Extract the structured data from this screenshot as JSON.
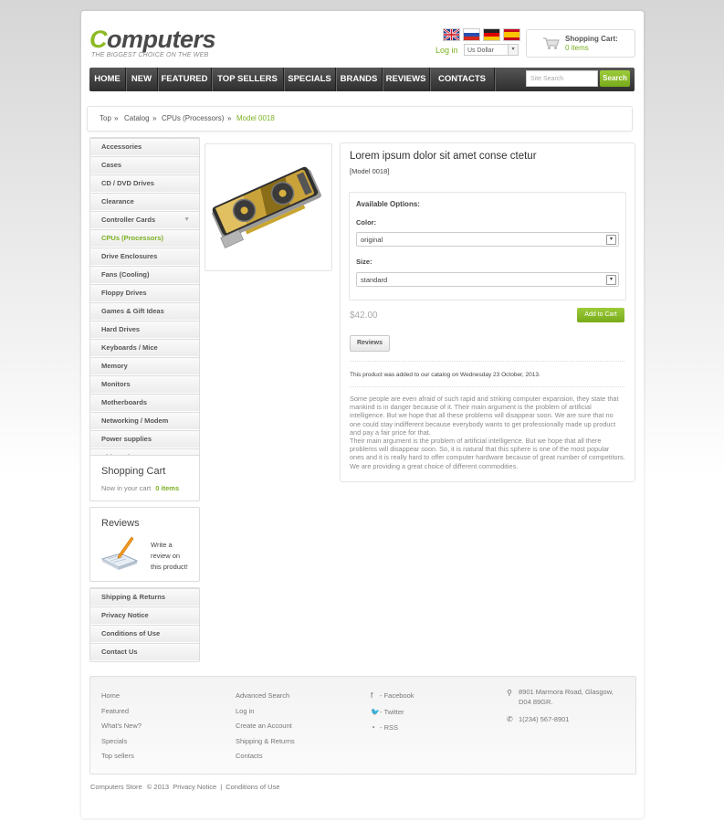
{
  "header": {
    "logo_first_letter": "C",
    "logo_rest": "omputers",
    "tagline": "THE BIGGEST CHOICE ON THE WEB",
    "login_label": "Log in",
    "currency_selected": "Us Dollar",
    "cart_title": "Shopping Cart:",
    "cart_items": "0 items",
    "flags": [
      "uk-flag-icon",
      "russia-flag-icon",
      "germany-flag-icon",
      "spain-flag-icon"
    ]
  },
  "nav": {
    "items": [
      "HOME",
      "NEW",
      "FEATURED",
      "TOP SELLERS",
      "SPECIALS",
      "BRANDS",
      "REVIEWS",
      "CONTACTS"
    ],
    "search_placeholder": "Site Search",
    "search_button": "Search"
  },
  "breadcrumb": {
    "items": [
      "Top",
      "Catalog",
      "CPUs (Processors)",
      "Model 0018"
    ],
    "separator": "»"
  },
  "categories": [
    "Accessories",
    "Cases",
    "CD / DVD Drives",
    "Clearance",
    "Controller Cards",
    "CPUs (Processors)",
    "Drive Enclosures",
    "Fans (Cooling)",
    "Floppy Drives",
    "Games & Gift Ideas",
    "Hard Drives",
    "Keyboards / Mice",
    "Memory",
    "Monitors",
    "Motherboards",
    "Networking / Modem",
    "Power supplies",
    "Video adapters"
  ],
  "active_category": "CPUs (Processors)",
  "sidebar_cart": {
    "title": "Shopping Cart",
    "text": "Now in your cart",
    "items": "0 items"
  },
  "sidebar_reviews": {
    "title": "Reviews",
    "line1": "Write a",
    "line2": "review on",
    "line3": "this product!"
  },
  "info_links": [
    "Shipping & Returns",
    "Privacy Notice",
    "Conditions of Use",
    "Contact Us"
  ],
  "product": {
    "title": "Lorem ipsum dolor sit amet conse ctetur",
    "model": "[Model 0018]",
    "options_heading": "Available Options:",
    "color_label": "Color:",
    "color_value": "original",
    "size_label": "Size:",
    "size_value": "standard",
    "price": "$42.00",
    "add_to_cart": "Add to Cart",
    "reviews_button": "Reviews",
    "added_text": "This product was added to our catalog on Wednesday 23 October, 2013.",
    "description_1": "Some people are even afraid of such rapid and striking computer expansion, they state that mankind is in danger because of it. Their main argument is the problem of artificial intelligence. But we hope that all these problems will disappear soon. We are sure that no one could stay indifferent because everybody wants to get professionally made up product and pay a fair price for that.",
    "description_2": "Their main argument is the problem of artificial intelligence. But we hope that all there problems will disappear soon. So, it is natural that this sphere is one of the most popular ones and it is really hard to offer computer hardware because of great number of competitors. We are providing a great choice of different commodities."
  },
  "footer": {
    "col1": [
      "Home",
      "Featured",
      "What's New?",
      "Specials",
      "Top sellers"
    ],
    "col2": [
      "Advanced Search",
      "Log in",
      "Create an Account",
      "Shipping & Returns",
      "Contacts"
    ],
    "social": [
      "- Facebook",
      "- Twitter",
      "- RSS"
    ],
    "address_line1": "8901 Marmora Road, Glasgow,",
    "address_line2": "D04 89GR.",
    "phone": "1(234) 567-8901"
  },
  "copyright": {
    "store": "Computers Store",
    "year": "© 2013",
    "privacy": "Privacy Notice",
    "sep": "|",
    "conditions": "Conditions of Use"
  },
  "colors": {
    "accent": "#7bb022",
    "nav_bg": "#3a3a3a"
  }
}
